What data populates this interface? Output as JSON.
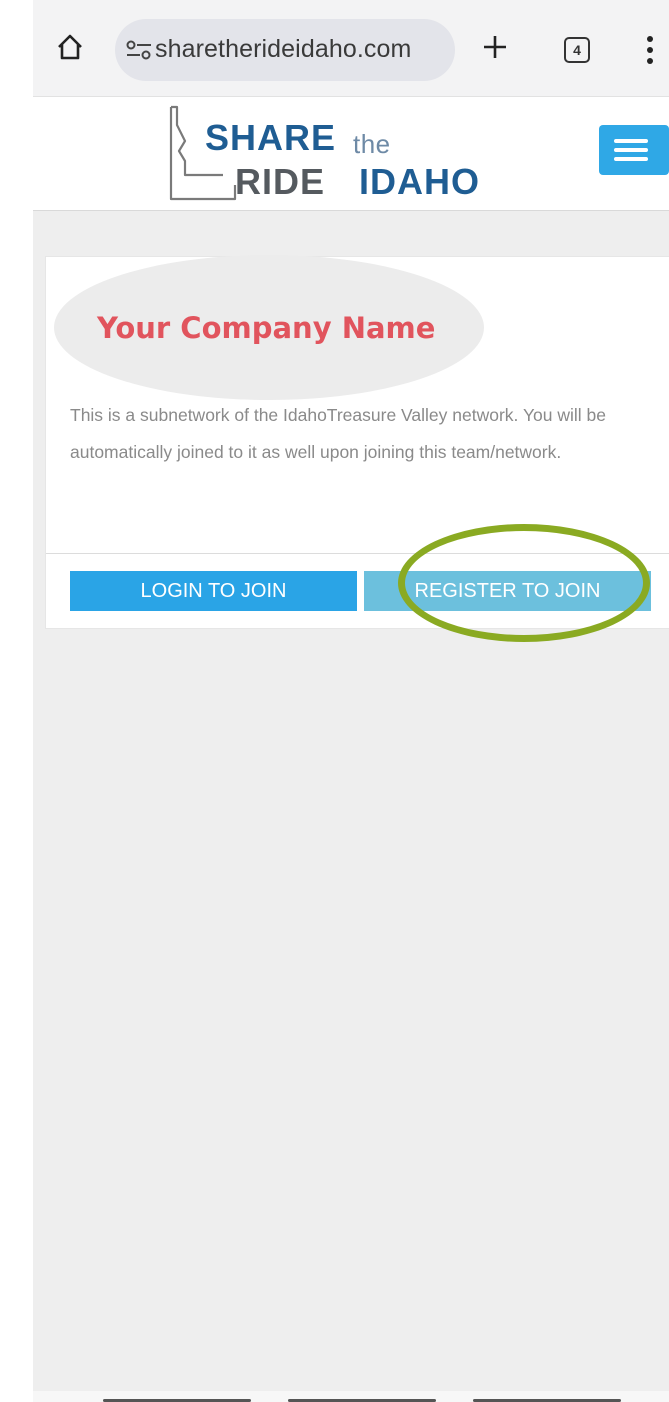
{
  "browser": {
    "url": "sharetherideidaho.com",
    "tab_count": "4",
    "icons": [
      "home-icon",
      "site-settings-icon",
      "new-tab-icon",
      "tabs-icon",
      "more-menu-icon"
    ]
  },
  "header": {
    "logo": {
      "share": "SHARE",
      "the": "the",
      "ride": "RIDE",
      "idaho": "IDAHO"
    },
    "menu_icon": "hamburger-icon",
    "menu_color": "#2fa8e6"
  },
  "card": {
    "company_name": "Your Company Name",
    "company_color": "#e1545d",
    "description": "This is a subnetwork of the IdahoTreasure Valley network. You will be automatically joined to it as well upon joining this team/network.",
    "login_button": "LOGIN TO JOIN",
    "register_button": "REGISTER TO JOIN",
    "login_color": "#2aa4e6",
    "register_color": "#6cc0dd"
  },
  "annotation": {
    "highlight_color": "#8aaa22"
  }
}
